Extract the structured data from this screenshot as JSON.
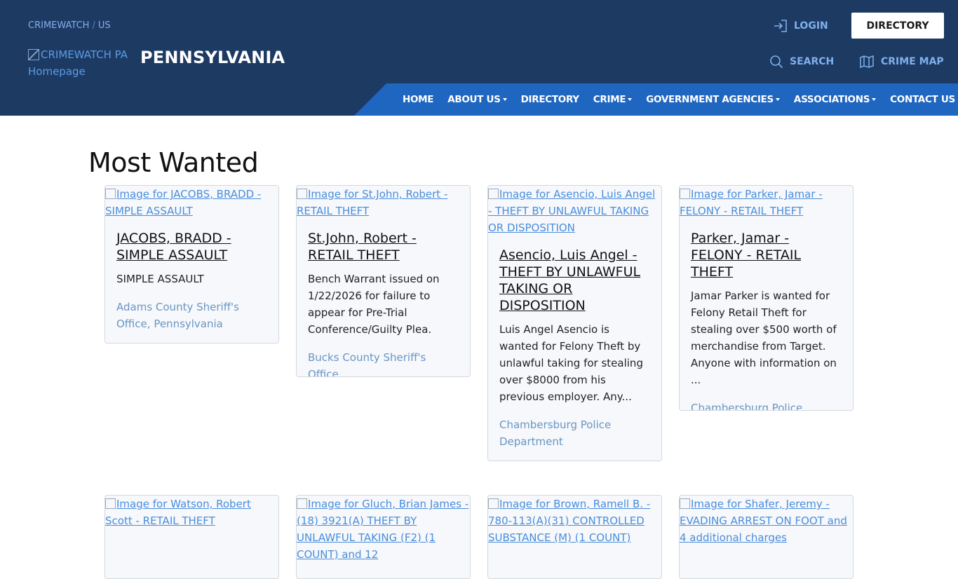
{
  "breadcrumb": {
    "part1": "CRIMEWATCH",
    "separator": "/",
    "part2": "US"
  },
  "logo": {
    "alt": "CRIMEWATCH PA Homepage"
  },
  "state_title": "PENNSYLVANIA",
  "top_actions": {
    "login": "LOGIN",
    "directory": "DIRECTORY",
    "search": "SEARCH",
    "crime_map": "CRIME MAP"
  },
  "nav": {
    "items": [
      {
        "label": "HOME",
        "dropdown": false
      },
      {
        "label": "ABOUT US",
        "dropdown": true
      },
      {
        "label": "DIRECTORY",
        "dropdown": false
      },
      {
        "label": "CRIME",
        "dropdown": true
      },
      {
        "label": "GOVERNMENT AGENCIES",
        "dropdown": true
      },
      {
        "label": "ASSOCIATIONS",
        "dropdown": true
      },
      {
        "label": "CONTACT US",
        "dropdown": false
      }
    ]
  },
  "main": {
    "title": "Most Wanted",
    "cards": [
      {
        "image_alt": "Image for JACOBS, BRADD - SIMPLE ASSAULT",
        "title": "JACOBS, BRADD - SIMPLE ASSAULT",
        "description": "SIMPLE ASSAULT",
        "agency": "Adams County Sheriff's Office, Pennsylvania"
      },
      {
        "image_alt": "Image for St.John, Robert - RETAIL THEFT",
        "title": "St.John, Robert - RETAIL THEFT",
        "description": "Bench Warrant issued on 1/22/2026 for failure to appear for Pre-Trial Conference/Guilty Plea.",
        "agency": "Bucks County Sheriff's Office"
      },
      {
        "image_alt": "Image for Asencio, Luis Angel - THEFT BY UNLAWFUL TAKING OR DISPOSITION",
        "title": "Asencio, Luis Angel - THEFT BY UNLAWFUL TAKING OR DISPOSITION",
        "description": " Luis Angel Asencio is wanted for Felony Theft by unlawful taking for stealing over $8000 from his previous employer. Any...",
        "agency": "Chambersburg Police Department"
      },
      {
        "image_alt": "Image for Parker, Jamar - FELONY - RETAIL THEFT",
        "title": "Parker, Jamar - FELONY - RETAIL THEFT",
        "description": "Jamar Parker is wanted for Felony Retail Theft for stealing over $500 worth of merchandise from Target. Anyone with information on ...",
        "agency": "Chambersburg Police Department"
      },
      {
        "image_alt": "Image for Watson, Robert Scott - RETAIL THEFT",
        "title": "",
        "description": "",
        "agency": ""
      },
      {
        "image_alt": "Image for Gluch, Brian James - (18) 3921(A) THEFT BY UNLAWFUL TAKING (F2) (1 COUNT) and 12",
        "title": "",
        "description": "",
        "agency": ""
      },
      {
        "image_alt": "Image for Brown, Ramell B. - 780-113(A)(31) CONTROLLED SUBSTANCE (M) (1 COUNT)",
        "title": "",
        "description": "",
        "agency": ""
      },
      {
        "image_alt": "Image for Shafer, Jeremy - EVADING ARREST ON FOOT and 4 additional charges",
        "title": "",
        "description": "",
        "agency": ""
      }
    ]
  },
  "colors": {
    "header_bg": "#1d3a63",
    "nav_bg": "#1f66c1",
    "link": "#4a8ddc",
    "agency": "#6a95c4",
    "card_bg": "#f6f8fb"
  }
}
